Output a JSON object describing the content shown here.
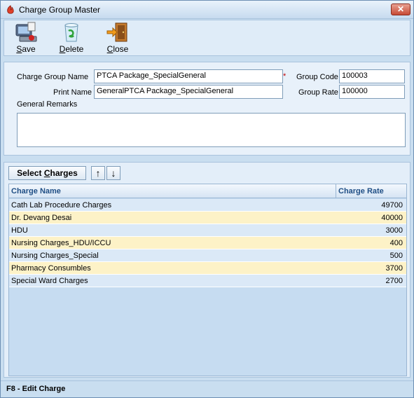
{
  "window": {
    "title": "Charge Group Master",
    "close_glyph": "✕"
  },
  "toolbar": {
    "save": {
      "key": "S",
      "rest": "ave",
      "icon": "save-icon"
    },
    "delete": {
      "key": "D",
      "rest": "elete",
      "icon": "recycle-bin-icon"
    },
    "close": {
      "key": "C",
      "rest": "lose",
      "icon": "exit-door-icon"
    }
  },
  "form": {
    "group_name_label": "Charge Group Name",
    "group_name_value": "PTCA Package_SpecialGeneral",
    "required_mark": "*",
    "print_name_label": "Print Name",
    "print_name_value": "GeneralPTCA Package_SpecialGeneral",
    "group_code_label": "Group Code",
    "group_code_value": "100003",
    "group_rate_label": "Group Rate",
    "group_rate_value": "100000",
    "remarks_label": "General Remarks",
    "remarks_value": ""
  },
  "charges": {
    "select_button": {
      "pre": "Select ",
      "key": "C",
      "post": "harges"
    },
    "move_up_glyph": "↑",
    "move_down_glyph": "↓",
    "columns": {
      "name": "Charge Name",
      "rate": "Charge Rate"
    },
    "rows": [
      {
        "name": "Cath Lab Procedure Charges",
        "rate": "49700"
      },
      {
        "name": "Dr. Devang Desai",
        "rate": "40000"
      },
      {
        "name": "HDU",
        "rate": "3000"
      },
      {
        "name": "Nursing Charges_HDU/ICCU",
        "rate": "400"
      },
      {
        "name": "Nursing Charges_Special",
        "rate": "500"
      },
      {
        "name": "Pharmacy Consumbles",
        "rate": "3700"
      },
      {
        "name": "Special Ward Charges",
        "rate": "2700"
      }
    ]
  },
  "status": {
    "text": "F8 - Edit Charge"
  },
  "colors": {
    "row_odd": "#dbe9f7",
    "row_even": "#fdf2c7",
    "header_text": "#1f4e85"
  }
}
